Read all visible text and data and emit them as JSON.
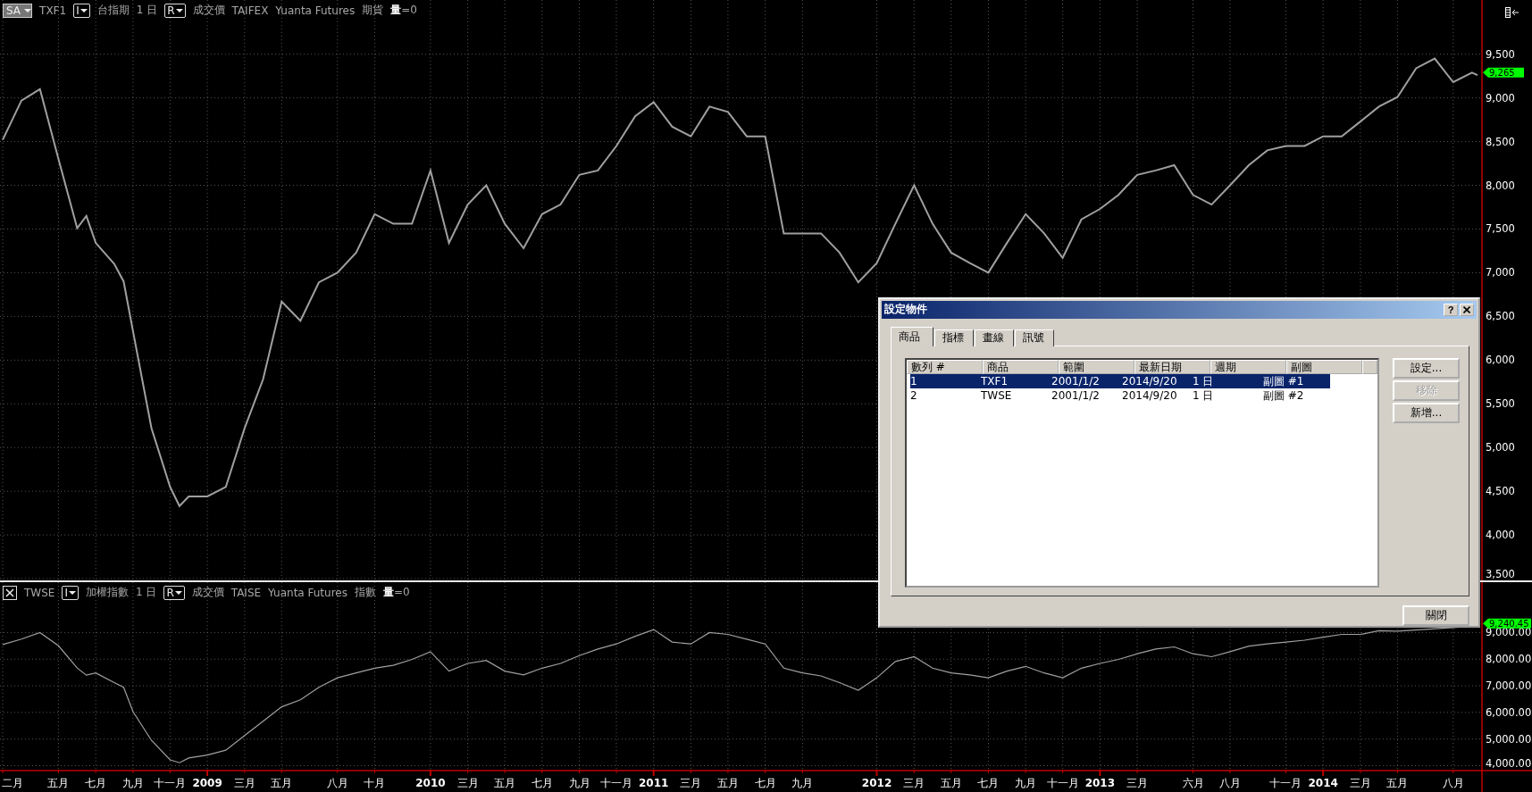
{
  "top_pane": {
    "header": [
      {
        "kind": "menu",
        "label": "SA"
      },
      {
        "kind": "series"
      },
      {
        "kind": "toggle",
        "label": "I"
      },
      {
        "kind": "text",
        "text": "台指期"
      },
      {
        "kind": "text",
        "text": "1 日"
      },
      {
        "kind": "toggle",
        "label": "R"
      },
      {
        "kind": "text",
        "text": "成交價"
      },
      {
        "kind": "text",
        "text": "TAIFEX"
      },
      {
        "kind": "text",
        "text": "Yuanta Futures"
      },
      {
        "kind": "text",
        "text": "期貨"
      },
      {
        "kind": "text",
        "text": "**量**=0"
      }
    ],
    "last_price": "9,265",
    "chart_data": {
      "type": "line",
      "x": [
        2008.083,
        2008.167,
        2008.25,
        2008.333,
        2008.417,
        2008.458,
        2008.5,
        2008.583,
        2008.625,
        2008.667,
        2008.75,
        2008.833,
        2008.875,
        2008.917,
        2009,
        2009.083,
        2009.167,
        2009.25,
        2009.333,
        2009.417,
        2009.5,
        2009.583,
        2009.667,
        2009.75,
        2009.833,
        2009.917,
        2010,
        2010.083,
        2010.167,
        2010.25,
        2010.333,
        2010.417,
        2010.5,
        2010.583,
        2010.667,
        2010.75,
        2010.833,
        2010.917,
        2011,
        2011.083,
        2011.167,
        2011.25,
        2011.333,
        2011.417,
        2011.5,
        2011.583,
        2011.667,
        2011.75,
        2011.833,
        2011.917,
        2012,
        2012.083,
        2012.167,
        2012.25,
        2012.333,
        2012.417,
        2012.5,
        2012.583,
        2012.667,
        2012.75,
        2012.833,
        2012.917,
        2013,
        2013.083,
        2013.167,
        2013.25,
        2013.333,
        2013.417,
        2013.5,
        2013.583,
        2013.667,
        2013.75,
        2013.833,
        2013.917,
        2014,
        2014.083,
        2014.167,
        2014.25,
        2014.333,
        2014.417,
        2014.5,
        2014.583,
        2014.667,
        2014.692
      ],
      "series": [
        {
          "name": "TXF1",
          "color": "#a0a0a0",
          "values": [
            8520,
            8970,
            9100,
            8300,
            7510,
            7650,
            7340,
            7100,
            6900,
            6330,
            5220,
            4550,
            4330,
            4440,
            4440,
            4550,
            5220,
            5780,
            6670,
            6450,
            6890,
            7000,
            7230,
            7670,
            7560,
            7560,
            8170,
            7340,
            7780,
            8000,
            7560,
            7280,
            7670,
            7780,
            8120,
            8170,
            8450,
            8790,
            8950,
            8670,
            8560,
            8900,
            8840,
            8560,
            8560,
            7450,
            7450,
            7450,
            7230,
            6890,
            7110,
            7560,
            8000,
            7560,
            7230,
            7110,
            7000,
            7340,
            7670,
            7450,
            7170,
            7610,
            7730,
            7890,
            8120,
            8170,
            8230,
            7890,
            7780,
            8000,
            8230,
            8400,
            8450,
            8450,
            8560,
            8560,
            8730,
            8900,
            9010,
            9340,
            9450,
            9180,
            9290,
            9260
          ]
        }
      ],
      "xlim": [
        2008.071,
        2014.936
      ],
      "ylim": [
        3480,
        10120
      ],
      "grid": true,
      "yticks": [
        {
          "value": 3500,
          "label": "3,500"
        },
        {
          "value": 4000,
          "label": "4,000"
        },
        {
          "value": 4500,
          "label": "4,500"
        },
        {
          "value": 5000,
          "label": "5,000"
        },
        {
          "value": 5500,
          "label": "5,500"
        },
        {
          "value": 6000,
          "label": "6,000"
        },
        {
          "value": 6500,
          "label": "6,500"
        },
        {
          "value": 7000,
          "label": "7,000"
        },
        {
          "value": 7500,
          "label": "7,500"
        },
        {
          "value": 8000,
          "label": "8,000"
        },
        {
          "value": 8500,
          "label": "8,500"
        },
        {
          "value": 9000,
          "label": "9,000"
        },
        {
          "value": 9500,
          "label": "9,500"
        }
      ]
    }
  },
  "bottom_pane": {
    "header": [
      {
        "kind": "close"
      },
      {
        "kind": "series"
      },
      {
        "kind": "toggle",
        "label": "I"
      },
      {
        "kind": "text",
        "text": "加權指數"
      },
      {
        "kind": "text",
        "text": "1 日"
      },
      {
        "kind": "toggle",
        "label": "R"
      },
      {
        "kind": "text",
        "text": "成交價"
      },
      {
        "kind": "text",
        "text": "TAISE"
      },
      {
        "kind": "text",
        "text": "Yuanta Futures"
      },
      {
        "kind": "text",
        "text": "指數"
      },
      {
        "kind": "text",
        "text": "**量**=0"
      }
    ],
    "last_price": "9,240.45",
    "chart_data": {
      "type": "line",
      "x": [
        2008.083,
        2008.167,
        2008.25,
        2008.333,
        2008.417,
        2008.458,
        2008.5,
        2008.583,
        2008.625,
        2008.667,
        2008.75,
        2008.833,
        2008.875,
        2008.917,
        2009,
        2009.083,
        2009.167,
        2009.25,
        2009.333,
        2009.417,
        2009.5,
        2009.583,
        2009.667,
        2009.75,
        2009.833,
        2009.917,
        2010,
        2010.083,
        2010.167,
        2010.25,
        2010.333,
        2010.417,
        2010.5,
        2010.583,
        2010.667,
        2010.75,
        2010.833,
        2010.917,
        2011,
        2011.083,
        2011.167,
        2011.25,
        2011.333,
        2011.417,
        2011.5,
        2011.583,
        2011.667,
        2011.75,
        2011.833,
        2011.917,
        2012,
        2012.083,
        2012.167,
        2012.25,
        2012.333,
        2012.417,
        2012.5,
        2012.583,
        2012.667,
        2012.75,
        2012.833,
        2012.917,
        2013,
        2013.083,
        2013.167,
        2013.25,
        2013.333,
        2013.417,
        2013.5,
        2013.583,
        2013.667,
        2013.75,
        2013.833,
        2013.917,
        2014,
        2014.083,
        2014.167,
        2014.25,
        2014.333,
        2014.692
      ],
      "series": [
        {
          "name": "TWSE",
          "color": "#a0a0a0",
          "values": [
            8550,
            8750,
            9000,
            8500,
            7670,
            7400,
            7480,
            7120,
            6940,
            6030,
            4950,
            4220,
            4110,
            4290,
            4400,
            4580,
            5130,
            5670,
            6210,
            6470,
            6940,
            7300,
            7480,
            7660,
            7770,
            7990,
            8280,
            7550,
            7840,
            7950,
            7550,
            7410,
            7660,
            7840,
            8130,
            8380,
            8570,
            8860,
            9110,
            8640,
            8570,
            9000,
            8930,
            8750,
            8570,
            7660,
            7480,
            7370,
            7120,
            6830,
            7300,
            7910,
            8090,
            7660,
            7480,
            7410,
            7300,
            7550,
            7730,
            7480,
            7300,
            7660,
            7840,
            7990,
            8200,
            8380,
            8460,
            8200,
            8090,
            8280,
            8490,
            8570,
            8640,
            8710,
            8820,
            8930,
            8930,
            9070,
            9050,
            9240
          ]
        }
      ],
      "xlim": [
        2008.071,
        2014.936
      ],
      "ylim": [
        3850,
        10890
      ],
      "grid": true,
      "yticks": [
        {
          "value": 4000,
          "label": "4,000.00"
        },
        {
          "value": 5000,
          "label": "5,000.00"
        },
        {
          "value": 6000,
          "label": "6,000.00"
        },
        {
          "value": 7000,
          "label": "7,000.00"
        },
        {
          "value": 8000,
          "label": "8,000.00"
        },
        {
          "value": 9000,
          "label": "9,000.00"
        }
      ],
      "xticks": [
        {
          "value": 2008.083,
          "label": "二月"
        },
        {
          "value": 2008.333,
          "label": "五月"
        },
        {
          "value": 2008.5,
          "label": "七月"
        },
        {
          "value": 2008.667,
          "label": "九月"
        },
        {
          "value": 2008.833,
          "label": "十一月"
        },
        {
          "value": 2009,
          "label": "2009"
        },
        {
          "value": 2009.167,
          "label": "三月"
        },
        {
          "value": 2009.333,
          "label": "五月"
        },
        {
          "value": 2009.583,
          "label": "八月"
        },
        {
          "value": 2009.75,
          "label": "十月"
        },
        {
          "value": 2010,
          "label": "2010"
        },
        {
          "value": 2010.167,
          "label": "三月"
        },
        {
          "value": 2010.333,
          "label": "五月"
        },
        {
          "value": 2010.5,
          "label": "七月"
        },
        {
          "value": 2010.667,
          "label": "九月"
        },
        {
          "value": 2010.833,
          "label": "十一月"
        },
        {
          "value": 2011,
          "label": "2011"
        },
        {
          "value": 2011.167,
          "label": "三月"
        },
        {
          "value": 2011.333,
          "label": "五月"
        },
        {
          "value": 2011.5,
          "label": "七月"
        },
        {
          "value": 2011.667,
          "label": "九月"
        },
        {
          "value": 2012,
          "label": "2012"
        },
        {
          "value": 2012.167,
          "label": "三月"
        },
        {
          "value": 2012.333,
          "label": "五月"
        },
        {
          "value": 2012.5,
          "label": "七月"
        },
        {
          "value": 2012.667,
          "label": "九月"
        },
        {
          "value": 2012.833,
          "label": "十一月"
        },
        {
          "value": 2013,
          "label": "2013"
        },
        {
          "value": 2013.167,
          "label": "三月"
        },
        {
          "value": 2013.417,
          "label": "六月"
        },
        {
          "value": 2013.583,
          "label": "八月"
        },
        {
          "value": 2013.833,
          "label": "十一月"
        },
        {
          "value": 2014,
          "label": "2014"
        },
        {
          "value": 2014.167,
          "label": "三月"
        },
        {
          "value": 2014.333,
          "label": "五月"
        },
        {
          "value": 2014.583,
          "label": "八月"
        }
      ]
    }
  },
  "dialog": {
    "title": "設定物件",
    "help": "?",
    "tabs": [
      {
        "label": "商品",
        "selected": true
      },
      {
        "label": "指標",
        "selected": false
      },
      {
        "label": "畫線",
        "selected": false
      },
      {
        "label": "訊號",
        "selected": false
      }
    ],
    "table": {
      "columns": [
        "數列 #",
        "商品",
        "範圍",
        "最新日期",
        "週期",
        "副圖"
      ],
      "rows": [
        {
          "cells": [
            "1",
            "TXF1",
            "2001/1/2",
            "2014/9/20",
            "1 日",
            "副圖 #1"
          ],
          "selected": true
        },
        {
          "cells": [
            "2",
            "TWSE",
            "2001/1/2",
            "2014/9/20",
            "1 日",
            "副圖 #2"
          ],
          "selected": false
        }
      ]
    },
    "buttons": [
      {
        "label": "設定...",
        "disabled": false
      },
      {
        "label": "移除",
        "disabled": true
      },
      {
        "label": "新增...",
        "disabled": false
      }
    ],
    "close_button": "關閉"
  }
}
